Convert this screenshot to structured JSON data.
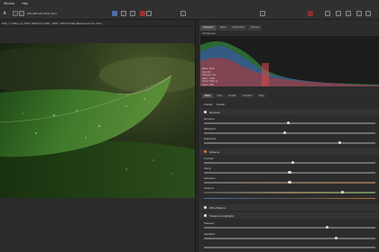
{
  "menu": [
    "Window",
    "Help"
  ],
  "toolbar": {
    "share_icon": "share-icon",
    "exif_info": "ISO 200  1/8 3.2mm  f/4.0"
  },
  "path": "DSC_1 / 400px_(H_DSP / 9000-F13 (F4M) - RAW - NIKON D300 (Manual Lens No CPU)",
  "panel": {
    "tabs": [
      "Histogram",
      "Editor",
      "Filebrowser",
      "Preview"
    ],
    "histogram_label": "All Channels",
    "info_lines": [
      "Mode: RGB",
      "ISO 200",
      "Sharpen: 0%",
      "Ratio: 1:100",
      "Photo: 5310 px",
      "Zoom: 25%"
    ],
    "tool_tabs": [
      "Basic",
      "Color",
      "Details",
      "Transform",
      "Raw"
    ],
    "preset_labels": [
      "Presets",
      "Default"
    ],
    "rows": [
      {
        "label": "Exposure",
        "pos": 0.49
      },
      {
        "label": "Blackpoint",
        "pos": 0.47
      },
      {
        "label": "Brightness",
        "pos": 0.79
      },
      {
        "label": "Contrast",
        "pos": 0.52
      },
      {
        "label": "Clarity",
        "pos": 0.5
      },
      {
        "label": "Saturation",
        "pos": 0.5
      },
      {
        "label": "Vibrance",
        "pos": 0.81
      },
      {
        "label": "Shadows",
        "pos": 0.72
      },
      {
        "label": "Highlights",
        "pos": 0.77
      }
    ],
    "sections": [
      "Exposure",
      "Enhance",
      "White Balance",
      "Shadows & Highlights"
    ]
  },
  "colors": {
    "accent": "#7fbf4a"
  }
}
